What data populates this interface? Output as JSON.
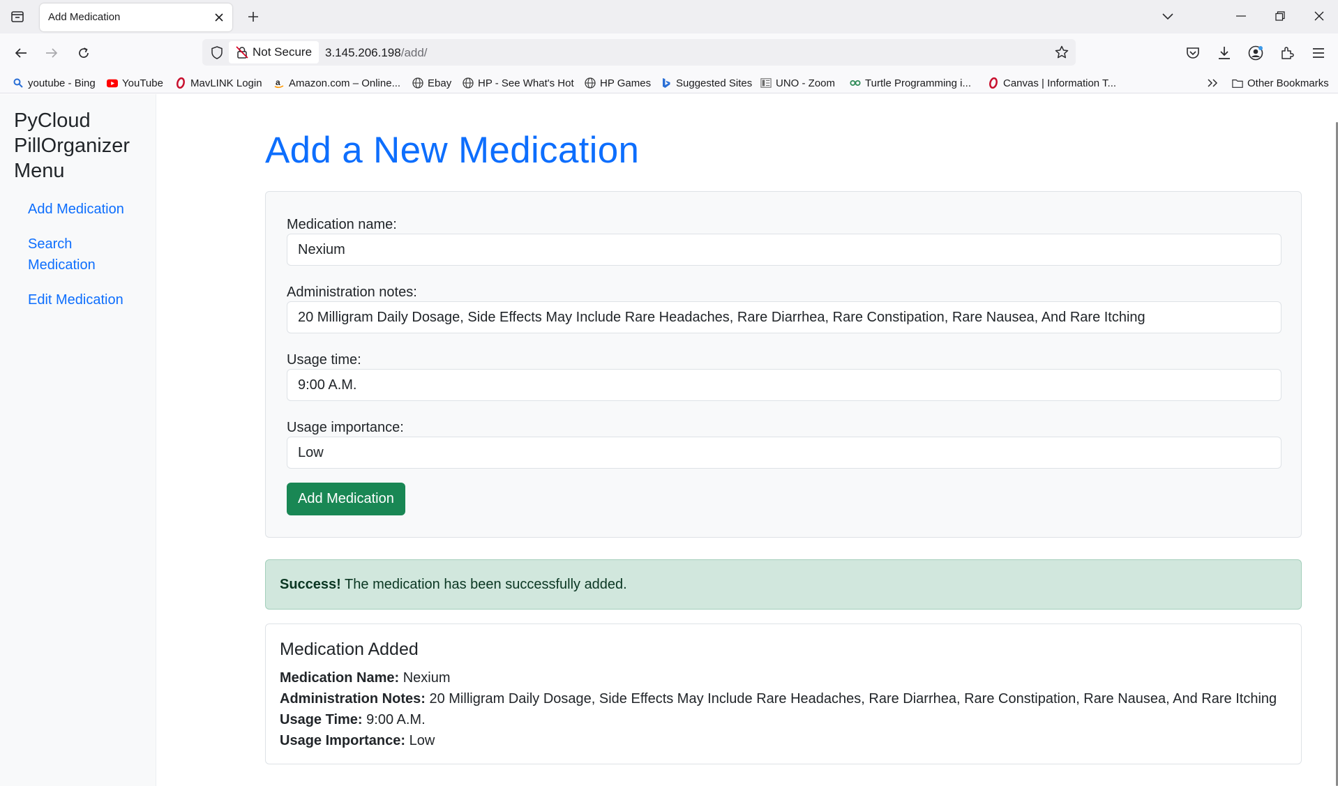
{
  "browser": {
    "tab_title": "Add Medication",
    "not_secure_label": "Not Secure",
    "url_host": "3.145.206.198",
    "url_path": "/add/",
    "bookmarks": [
      {
        "label": "youtube - Bing",
        "icon": "bing-search-icon",
        "color": "#2a6fd6"
      },
      {
        "label": "YouTube",
        "icon": "youtube-icon",
        "color": "#ff0000"
      },
      {
        "label": "MavLINK Login",
        "icon": "mavlink-icon",
        "color": "#c8102e"
      },
      {
        "label": "Amazon.com – Online...",
        "icon": "amazon-icon",
        "color": "#ff9900"
      },
      {
        "label": "Ebay",
        "icon": "globe-icon",
        "color": "#3a3a3a"
      },
      {
        "label": "HP - See What's Hot",
        "icon": "globe-icon",
        "color": "#3a3a3a"
      },
      {
        "label": "HP Games",
        "icon": "globe-icon",
        "color": "#3a3a3a"
      },
      {
        "label": "Suggested Sites",
        "icon": "bing-icon",
        "color": "#2a6fd6"
      },
      {
        "label": "UNO - Zoom",
        "icon": "document-icon",
        "color": "#6b6b6b"
      },
      {
        "label": "Turtle Programming i...",
        "icon": "turtle-icon",
        "color": "#2e8b57"
      },
      {
        "label": "Canvas | Information T...",
        "icon": "canvas-icon",
        "color": "#c8102e"
      }
    ],
    "other_bookmarks": "Other Bookmarks"
  },
  "sidebar": {
    "brand": "PyCloud PillOrganizer Menu",
    "links": [
      "Add Medication",
      "Search Medication",
      "Edit Medication"
    ]
  },
  "main": {
    "title": "Add a New Medication",
    "form": {
      "name_label": "Medication name:",
      "name_value": "Nexium",
      "notes_label": "Administration notes:",
      "notes_value": "20 Milligram Daily Dosage, Side Effects May Include Rare Headaches, Rare Diarrhea, Rare Constipation, Rare Nausea, And Rare Itching",
      "time_label": "Usage time:",
      "time_value": "9:00 A.M.",
      "importance_label": "Usage importance:",
      "importance_value": "Low",
      "submit_label": "Add Medication"
    },
    "alert": {
      "strong": "Success!",
      "message": "The medication has been successfully added."
    },
    "result": {
      "title": "Medication Added",
      "name_key": "Medication Name:",
      "name_value": "Nexium",
      "notes_key": "Administration Notes:",
      "notes_value": "20 Milligram Daily Dosage, Side Effects May Include Rare Headaches, Rare Diarrhea, Rare Constipation, Rare Nausea, And Rare Itching",
      "time_key": "Usage Time:",
      "time_value": "9:00 A.M.",
      "importance_key": "Usage Importance:",
      "importance_value": "Low"
    }
  },
  "colors": {
    "link_blue": "#0d6efd",
    "success_green": "#198754",
    "alert_bg": "#d1e7dd"
  }
}
